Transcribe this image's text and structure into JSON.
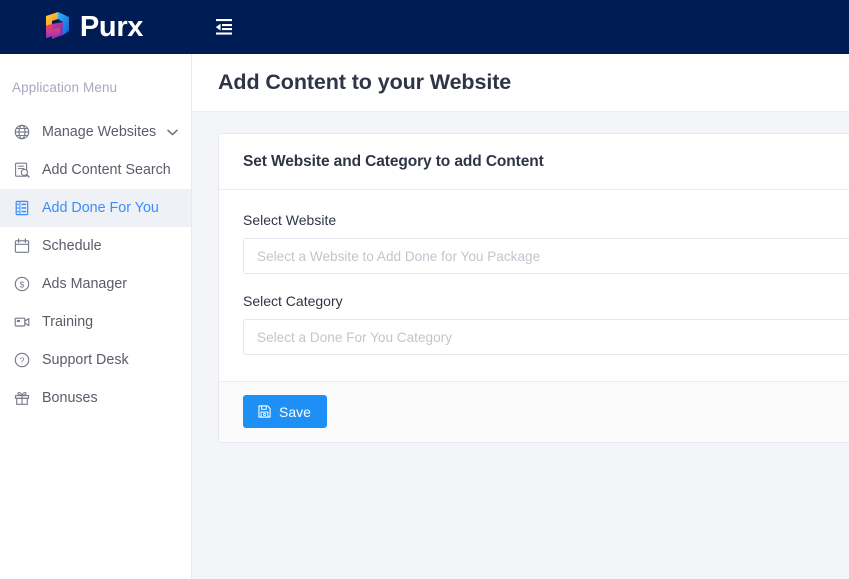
{
  "brand": {
    "name": "Purx",
    "logo_icon": "purx-gradient-ribbon-logo",
    "toggle_icon": "sidebar-collapse-icon"
  },
  "sidebar": {
    "heading": "Application Menu",
    "items": [
      {
        "label": "Manage Websites",
        "icon": "globe-icon",
        "active": false,
        "has_chevron": true,
        "chevron_icon": "chevron-down-icon"
      },
      {
        "label": "Add Content Search",
        "icon": "document-search-icon",
        "active": false,
        "has_chevron": false
      },
      {
        "label": "Add Done For You",
        "icon": "document-list-icon",
        "active": true,
        "has_chevron": false
      },
      {
        "label": "Schedule",
        "icon": "calendar-icon",
        "active": false,
        "has_chevron": false
      },
      {
        "label": "Ads Manager",
        "icon": "dollar-circle-icon",
        "active": false,
        "has_chevron": false
      },
      {
        "label": "Training",
        "icon": "video-camera-icon",
        "active": false,
        "has_chevron": false
      },
      {
        "label": "Support Desk",
        "icon": "question-circle-icon",
        "active": false,
        "has_chevron": false
      },
      {
        "label": "Bonuses",
        "icon": "gift-icon",
        "active": false,
        "has_chevron": false
      }
    ]
  },
  "page": {
    "title": "Add Content to your Website"
  },
  "card": {
    "header_title": "Set Website and Category to add Content",
    "fields": [
      {
        "label": "Select Website",
        "placeholder": "Select a Website to Add Done for You Package",
        "value": ""
      },
      {
        "label": "Select Category",
        "placeholder": "Select a Done For You Category",
        "value": ""
      }
    ],
    "save_label": "Save",
    "save_icon": "floppy-disk-save-icon"
  },
  "colors": {
    "navbar": "#001c54",
    "accent": "#1e90f5",
    "active_link": "#3c8dfb",
    "content_bg": "#f4f5f9",
    "card_footer_bg": "#fbfbfc"
  }
}
